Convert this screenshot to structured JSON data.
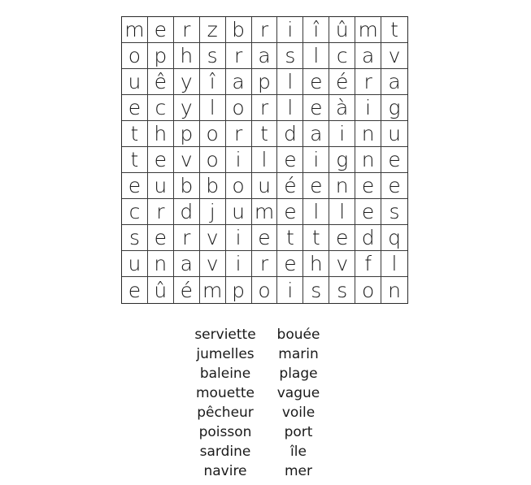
{
  "puzzle": {
    "grid": [
      [
        "m",
        "e",
        "r",
        "z",
        "b",
        "r",
        "i",
        "î",
        "û",
        "m",
        "t"
      ],
      [
        "o",
        "p",
        "h",
        "s",
        "r",
        "a",
        "s",
        "l",
        "c",
        "a",
        "v"
      ],
      [
        "u",
        "ê",
        "y",
        "î",
        "a",
        "p",
        "l",
        "e",
        "é",
        "r",
        "a"
      ],
      [
        "e",
        "c",
        "y",
        "l",
        "o",
        "r",
        "l",
        "e",
        "à",
        "i",
        "g"
      ],
      [
        "t",
        "h",
        "p",
        "o",
        "r",
        "t",
        "d",
        "a",
        "i",
        "n",
        "u"
      ],
      [
        "t",
        "e",
        "v",
        "o",
        "i",
        "l",
        "e",
        "i",
        "g",
        "n",
        "e"
      ],
      [
        "e",
        "u",
        "b",
        "b",
        "o",
        "u",
        "é",
        "e",
        "n",
        "e",
        "e"
      ],
      [
        "c",
        "r",
        "d",
        "j",
        "u",
        "m",
        "e",
        "l",
        "l",
        "e",
        "s"
      ],
      [
        "s",
        "e",
        "r",
        "v",
        "i",
        "e",
        "t",
        "t",
        "e",
        "d",
        "q"
      ],
      [
        "u",
        "n",
        "a",
        "v",
        "i",
        "r",
        "e",
        "h",
        "v",
        "f",
        "l"
      ],
      [
        "e",
        "û",
        "é",
        "m",
        "p",
        "o",
        "i",
        "s",
        "s",
        "o",
        "n"
      ]
    ],
    "words_left": [
      "serviette",
      "jumelles",
      "baleine",
      "mouette",
      "pêcheur",
      "poisson",
      "sardine",
      "navire"
    ],
    "words_right": [
      "bouée",
      "marin",
      "plage",
      "vague",
      "voile",
      "port",
      "île",
      "mer"
    ]
  }
}
